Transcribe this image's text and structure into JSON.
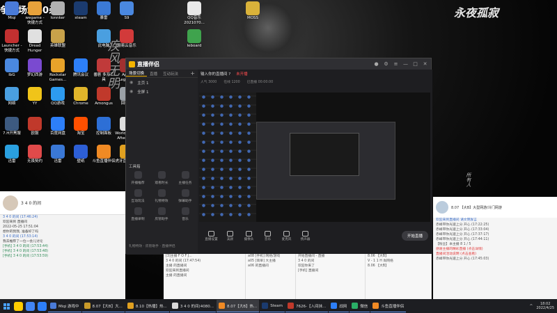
{
  "overlay_title": "争取场均60杀",
  "desktop_icons": [
    {
      "label": "Miqi",
      "color": "#4a7bd8"
    },
    {
      "label": "wegame - 快捷方式",
      "color": "#e7a23b"
    },
    {
      "label": "lonnker",
      "color": "#b0b0b0"
    },
    {
      "label": "steam",
      "color": "#1b3b6f"
    },
    {
      "label": "暴雷",
      "color": "#3b7ad6"
    },
    {
      "label": "S9",
      "color": "#4a88e0"
    },
    {
      "label": "QQ音乐 2021070...",
      "color": "#e8e8e8"
    },
    {
      "label": "Launcher - 快捷方式",
      "color": "#c23030"
    },
    {
      "label": "Dread Hunger",
      "color": "#e0e0e0"
    },
    {
      "label": "英雄联盟",
      "color": "#c8a24a"
    },
    {
      "label": "MOSS",
      "color": "#d9b23a"
    },
    {
      "label": "此电脑",
      "color": "#4a9fe0"
    },
    {
      "label": "网易云音乐",
      "color": "#d23a3a"
    },
    {
      "label": "Ieboard",
      "color": "#3fa34d"
    },
    {
      "label": "IbG",
      "color": "#4a88e0"
    },
    {
      "label": "梦幻西游",
      "color": "#7a4ad0"
    },
    {
      "label": "Rockstar Games...",
      "color": "#e8a32a"
    },
    {
      "label": "腾讯会议",
      "color": "#2d7ff9"
    },
    {
      "label": "番剧 多开工具",
      "color": "#c03a3a"
    },
    {
      "label": "Apex Legends",
      "color": "#a03030"
    },
    {
      "label": "DNF盒子",
      "color": "#c64a2a"
    },
    {
      "label": "网络",
      "color": "#4a9fe0"
    },
    {
      "label": "YY",
      "color": "#f0c419"
    },
    {
      "label": "QQ游戏",
      "color": "#2d9bf0"
    },
    {
      "label": "Chrome",
      "color": "#e0b52a"
    },
    {
      "label": "Amongus",
      "color": "#c0392b"
    },
    {
      "label": "回收站",
      "color": "#9aa0a6"
    },
    {
      "label": "微信",
      "color": "#2aae67"
    },
    {
      "label": "7.H开黑服",
      "color": "#3d5a80"
    },
    {
      "label": "欧服",
      "color": "#c0392b"
    },
    {
      "label": "百度网盘",
      "color": "#2d7ff9"
    },
    {
      "label": "淘宝",
      "color": "#ff5000"
    },
    {
      "label": "控制面板",
      "color": "#2d6fd6"
    },
    {
      "label": "World War Z Aftermath",
      "color": "#ddd"
    },
    {
      "label": "SEGA游戏中心",
      "color": "#3a78d6"
    },
    {
      "label": "迅雷",
      "color": "#2aa0e0"
    },
    {
      "label": "无畏契约",
      "color": "#e04a4a"
    },
    {
      "label": "迅雷",
      "color": "#3a78d6"
    },
    {
      "label": "壁纸",
      "color": "#2d5fd6"
    },
    {
      "label": "斗鱼直播伴侣",
      "color": "#f08a24"
    },
    {
      "label": "虎牙直播助手",
      "color": "#e0a020"
    },
    {
      "label": "Photoshop 2021",
      "color": "#1f3b6a"
    }
  ],
  "app": {
    "title": "直播伴侣",
    "tabs": [
      "场景切换",
      "直播",
      "互动玩法"
    ],
    "scenes": [
      "主页 1",
      "全屏 1"
    ],
    "tools_title": "工具箱",
    "tools": [
      "开播推荐",
      "观看时长",
      "主播任务",
      "互动玩法",
      "礼物特效",
      "弹幕助手",
      "直播录制",
      "房管助手",
      "音乐"
    ],
    "bottom_note": "礼物特效 · 房管助手 · 直播伴侣",
    "live_title": "输入你的直播间 ?",
    "live_tag": "未开播",
    "sub_items": [
      "人气 3000",
      "在线 1200",
      "已直播 00:00:00"
    ],
    "controls": [
      "直播设置",
      "美颜",
      "摄像头",
      "音乐",
      "麦克风",
      "扬声器"
    ],
    "go_live": "开始直播"
  },
  "chat_left": {
    "room": "3 4 0 的间",
    "messages": [
      {
        "text": "3 4 0 的间 (17:46:24)",
        "type": "b"
      },
      {
        "text": "欢迎来到 直播间",
        "type": ""
      },
      {
        "text": "2022-05-25 17:51:04",
        "type": ""
      },
      {
        "text": "想你的我我, 准备好了吗",
        "type": ""
      },
      {
        "text": "3 4 0 的间 (17:53:14)",
        "type": "b"
      },
      {
        "text": "我去推荐了一位一会儿讨论",
        "type": ""
      },
      {
        "text": "[手机] 3 4 0 的间 (17:53:44)",
        "type": "g"
      },
      {
        "text": "[手机] 3 4 0 的间 (17:53:48)",
        "type": "g"
      },
      {
        "text": "[手机] 3 4 0 的间 (17:53:59)",
        "type": "g"
      }
    ]
  },
  "chat_right": {
    "room": "8.07 【大B】大型网游/冷门网游",
    "messages": [
      {
        "text": "欢迎来到直播间 请文明发言",
        "type": "b"
      },
      {
        "text": "赤峰带你光速上分 开心 (17:22:25)",
        "type": ""
      },
      {
        "text": "赤峰带你光速上分 开心 (17:33:04)",
        "type": ""
      },
      {
        "text": "赤峰带你光速上分 开心 (17:37:17)",
        "type": ""
      },
      {
        "text": "赤峰带你光速上分 开心 (17:44:11)",
        "type": ""
      },
      {
        "text": "【粉丝】本主播 8 1 / 5",
        "type": ""
      },
      {
        "text": "感谢主播的精彩直播 (点击详情)",
        "type": "r"
      },
      {
        "text": "直播间活动说明 (点击查看)",
        "type": "r"
      },
      {
        "text": "赤峰带你光速上分 开心 (17:45:03)",
        "type": ""
      }
    ]
  },
  "mid_columns": [
    [
      "[3]主播 F O F J...",
      "3 4 0 的间 (17:47:54)",
      "主播 的直播间",
      "欢迎来到直播间",
      "主播 的直播间"
    ],
    [
      "a08 [手机] 网络/游戏",
      "a05 [简单] 大主播",
      "a06 的直播间"
    ],
    [
      "开始直播间 - 直播",
      "3 4 0 的间",
      "欢迎你来了",
      "[手机] 直播间"
    ],
    [
      "8.06 【大B】",
      "V - 1 1 H 尚网络",
      "8.06 【大B】"
    ]
  ],
  "taskbar": {
    "tasks": [
      {
        "label": "Miqi 游戏中",
        "color": "#4a7bd8"
      },
      {
        "label": "8.07【大B】大...",
        "color": "#c89a2a"
      },
      {
        "label": "8.10【热播】热...",
        "color": "#e0a020"
      },
      {
        "label": "3 4 0 的间(4080...",
        "color": "#d9d9d9"
      },
      {
        "label": "8.07【大B】热...",
        "color": "#f08a24"
      },
      {
        "label": "Steam",
        "color": "#1b3b6f"
      },
      {
        "label": "7626-【入间抹...",
        "color": "#c0392b"
      },
      {
        "label": "战网",
        "color": "#2d7ff9"
      },
      {
        "label": "微信",
        "color": "#2aae67"
      },
      {
        "label": "斗鱼直播伴侣",
        "color": "#f08a24"
      }
    ],
    "time": "18:02",
    "date": "2022/4/25"
  },
  "colors": {
    "accent": "#f4b400",
    "live_red": "#ff4d4f",
    "taskbar": "#1d1e22"
  }
}
